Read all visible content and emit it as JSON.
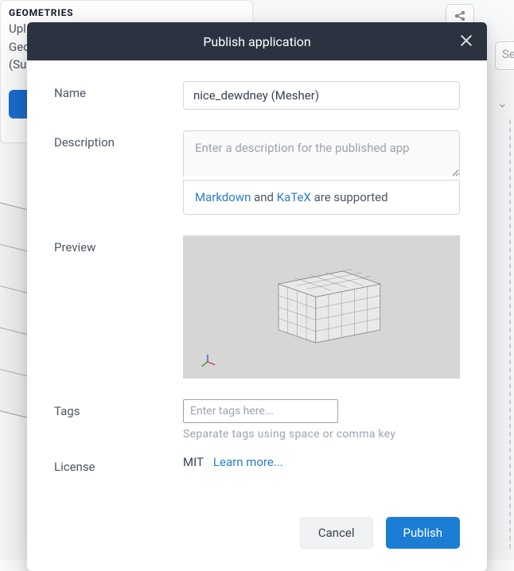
{
  "bg": {
    "panel_title": "GEOMETRIES",
    "panel_line1": "Upl",
    "panel_line2": "Gec",
    "panel_line3": "(Su",
    "search_fragment": "Se"
  },
  "modal": {
    "title": "Publish application",
    "name_label": "Name",
    "name_value": "nice_dewdney (Mesher)",
    "description_label": "Description",
    "description_placeholder": "Enter a description for the published app",
    "description_help_prefix": "",
    "markdown_link": "Markdown",
    "and_text": " and ",
    "katex_link": "KaTeX",
    "supported_text": " are supported",
    "preview_label": "Preview",
    "tags_label": "Tags",
    "tags_placeholder": "Enter tags here...",
    "tags_help": "Separate tags using space or comma key",
    "license_label": "License",
    "license_value": "MIT",
    "license_link": "Learn more...",
    "cancel": "Cancel",
    "publish": "Publish"
  }
}
